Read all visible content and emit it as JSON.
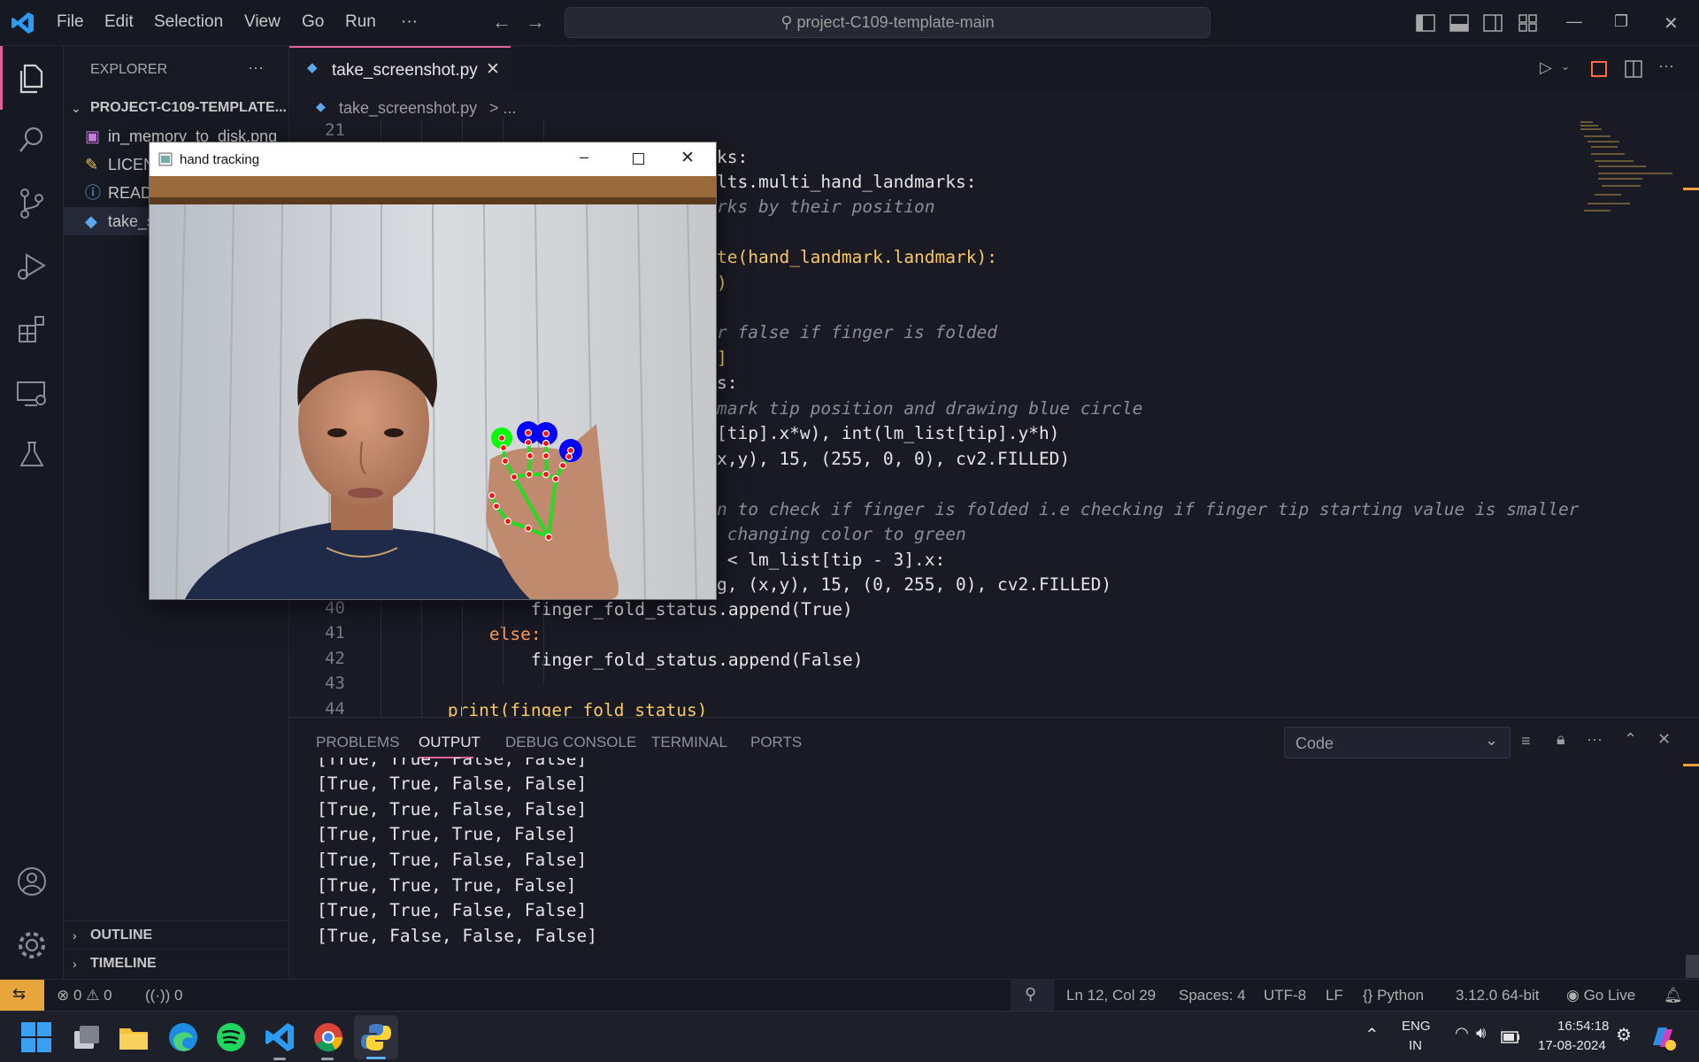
{
  "titlebar": {
    "menu": [
      "File",
      "Edit",
      "Selection",
      "View",
      "Go",
      "Run",
      "···"
    ],
    "search": "project-C109-template-main"
  },
  "explorer": {
    "header": "EXPLORER",
    "more": "···",
    "project": "PROJECT-C109-TEMPLATE...",
    "files": [
      "in_memory_to_disk.png",
      "LICENSE",
      "README.md",
      "take_screenshot.py"
    ],
    "outline": "OUTLINE",
    "timeline": "TIMELINE"
  },
  "editor": {
    "tab": "take_screenshot.py",
    "breadcrumb_file": "take_screenshot.py",
    "breadcrumb_rest": "> ...",
    "line_numbers": {
      "first": "21",
      "l40": "40",
      "l41": "41",
      "l42": "42",
      "l43": "43",
      "l44": "44"
    },
    "visible_fragments": {
      "l22": "ks:",
      "l23": "lts.multi_hand_landmarks:",
      "l24": "rks by their position",
      "l26": "te(hand_landmark.landmark):",
      "l27": ")",
      "l29": "r false if finger is folded",
      "l30": "]",
      "l31": "s:",
      "l32": "mark tip position and drawing blue circle",
      "l33": "[tip].x*w), int(lm_list[tip].y*h)",
      "l34": "x,y), 15, (255, 0, 0), cv2.FILLED)",
      "l36": "n to check if finger is folded i.e checking if finger tip starting value is smaller",
      "l37": " changing color to green",
      "l38": " < lm_list[tip - 3].x:",
      "l39": "g, (x,y), 15, (0, 255, 0), cv2.FILLED)",
      "l40": "                finger_fold_status.append(True)",
      "l41": "            else:",
      "l42": "                finger_fold_status.append(False)",
      "l44": "        print(finger_fold_status)"
    }
  },
  "panel": {
    "tabs": [
      "PROBLEMS",
      "OUTPUT",
      "DEBUG CONSOLE",
      "TERMINAL",
      "PORTS"
    ],
    "active_tab": "OUTPUT",
    "channel": "Code",
    "output": [
      "[True, True, False, False]",
      "[True, True, False, False]",
      "[True, True, False, False]",
      "[True, True, True, False]",
      "[True, True, False, False]",
      "[True, True, True, False]",
      "[True, True, False, False]",
      "[True, False, False, False]"
    ]
  },
  "statusbar": {
    "errors": "0",
    "warnings": "0",
    "ports": "0",
    "position": "Ln 12, Col 29",
    "spaces": "Spaces: 4",
    "encoding": "UTF-8",
    "eol": "LF",
    "language": "Python",
    "interpreter": "3.12.0 64-bit",
    "golive": "Go Live"
  },
  "hand_window": {
    "title": "hand tracking"
  },
  "taskbar": {
    "lang1": "ENG",
    "lang2": "IN",
    "time": "16:54:18",
    "date": "17-08-2024"
  },
  "colors": {
    "accent": "#e0609a",
    "background": "#191a24",
    "hand_skeleton": "#22dd22",
    "tip_unfolded": "#0000ff",
    "tip_folded": "#00ff00"
  }
}
